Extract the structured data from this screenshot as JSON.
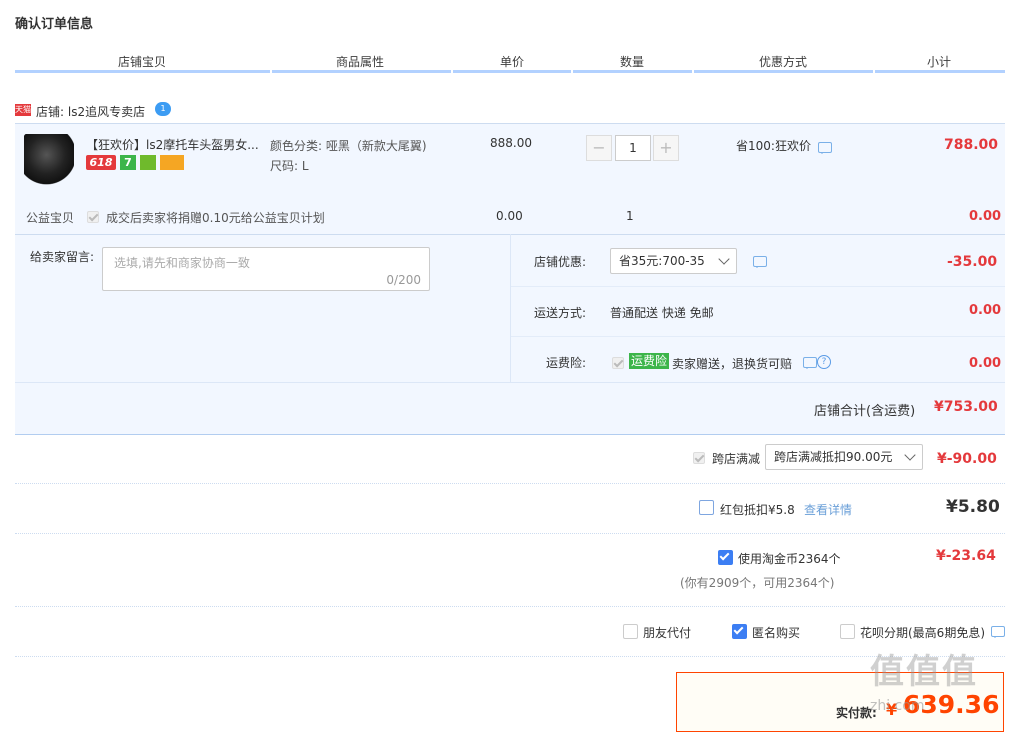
{
  "page_title": "确认订单信息",
  "columns": [
    "店铺宝贝",
    "商品属性",
    "单价",
    "数量",
    "优惠方式",
    "小计"
  ],
  "shop": {
    "badge": "天猫",
    "name": "店铺: ls2追风专卖店",
    "chat_badge": "1"
  },
  "item": {
    "title": "【狂欢价】ls2摩托车头盔男女...",
    "badges": [
      "618",
      "7",
      "",
      ""
    ],
    "attr_color": "颜色分类: 哑黑（新款大尾翼)",
    "attr_size": "尺码: L",
    "price": "888.00",
    "quantity": "1",
    "discount": "省100:狂欢价",
    "subtotal": "788.00",
    "minus": "−",
    "plus": "+"
  },
  "charity": {
    "label": "公益宝贝",
    "text": "成交后卖家将捐赠0.10元给公益宝贝计划",
    "price": "0.00",
    "qty": "1",
    "subtotal": "0.00"
  },
  "message": {
    "label": "给卖家留言:",
    "placeholder": "选填,请先和商家协商一致",
    "counter": "0/200"
  },
  "shop_discount": {
    "label": "店铺优惠:",
    "value": "省35元:700-35",
    "amount": "-35.00"
  },
  "shipping": {
    "label": "运送方式:",
    "value": "普通配送 快递 免邮",
    "amount": "0.00"
  },
  "insurance": {
    "label": "运费险:",
    "tag": "运费险",
    "text": "卖家赠送，退换货可赔",
    "amount": "0.00",
    "help": "?"
  },
  "shop_total": {
    "label": "店铺合计(含运费)",
    "amount": "¥753.00"
  },
  "cross_store": {
    "label": "跨店满减",
    "value": "跨店满减抵扣90.00元",
    "amount": "¥-90.00"
  },
  "red_packet": {
    "label": "红包抵扣¥5.8",
    "link": "查看详情",
    "amount": "¥5.80"
  },
  "coins": {
    "label": "使用淘金币2364个",
    "sub": "(你有2909个，可用2364个)",
    "amount": "¥-23.64"
  },
  "options": {
    "friend_pay": "朋友代付",
    "anonymous": "匿名购买",
    "huabei": "花呗分期(最高6期免息)"
  },
  "final": {
    "label": "实付款:",
    "currency": "¥",
    "amount": "639.36"
  },
  "watermark": "值值值",
  "watermark_url": "zhi.com"
}
